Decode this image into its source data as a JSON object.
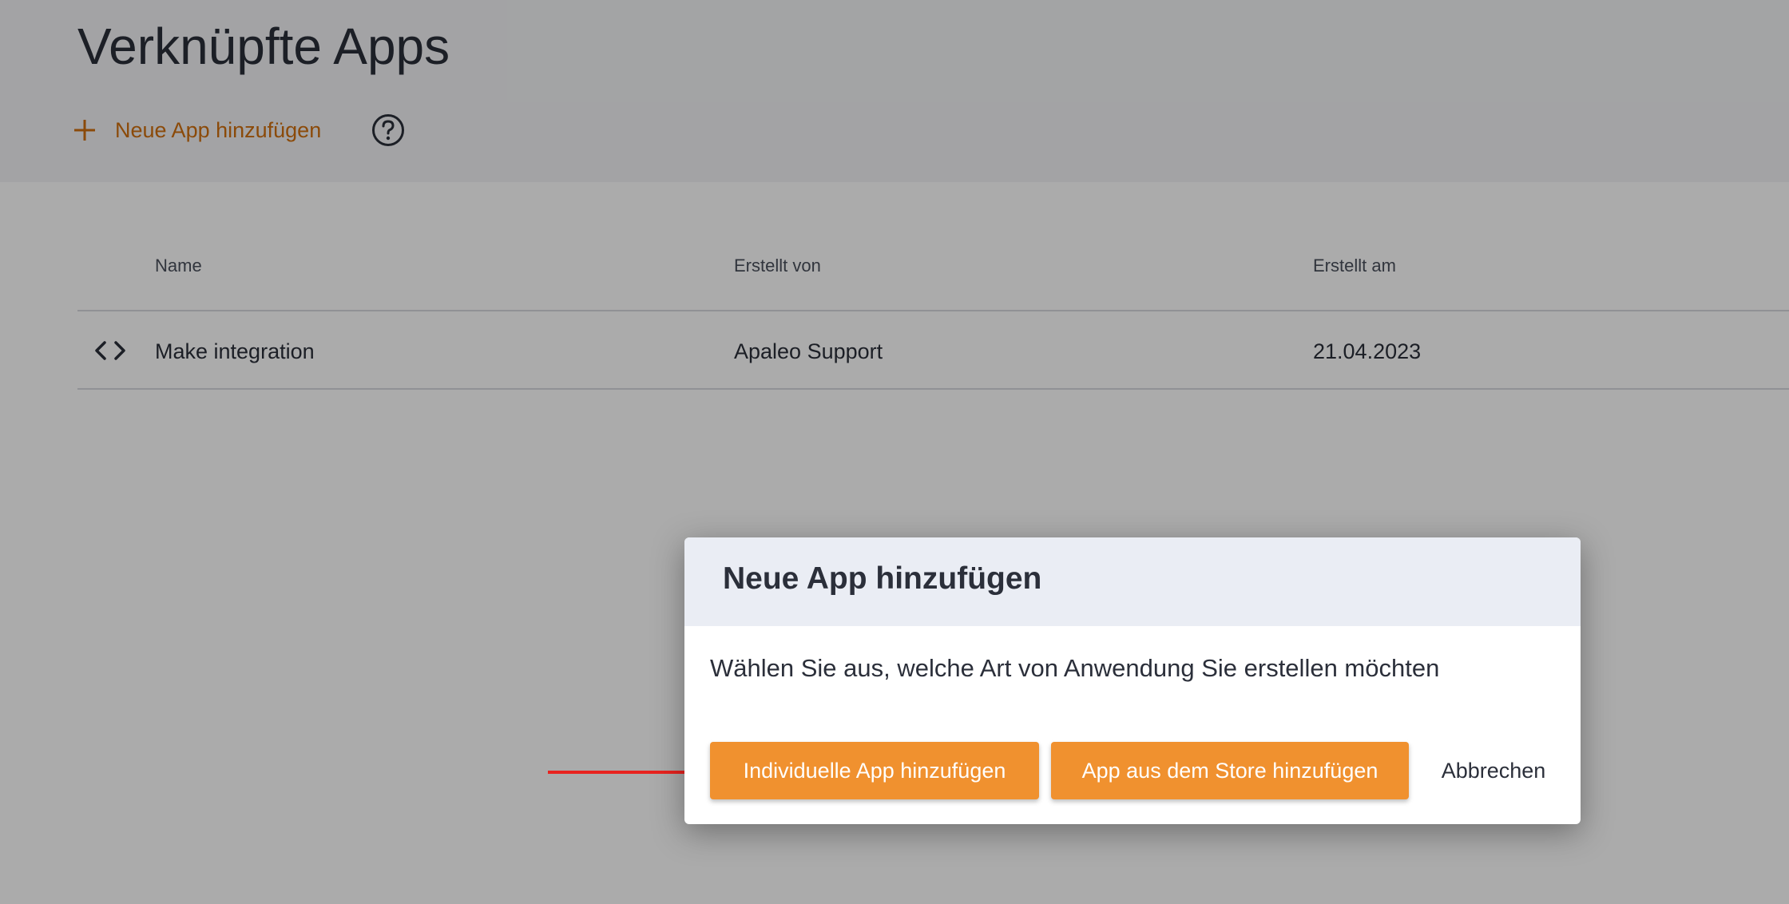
{
  "page": {
    "title": "Verknüpfte Apps",
    "add_app_label": "Neue App hinzufügen"
  },
  "icons": {
    "plus": "plus-icon",
    "help": "help-circle-icon",
    "code": "code-icon",
    "arrow": "arrow-right-icon"
  },
  "table": {
    "columns": [
      "Name",
      "Erstellt von",
      "Erstellt am"
    ],
    "rows": [
      {
        "name": "Make integration",
        "created_by": "Apaleo Support",
        "created_at": "21.04.2023"
      }
    ]
  },
  "dialog": {
    "title": "Neue App hinzufügen",
    "message": "Wählen Sie aus, welche Art von Anwendung Sie erstellen möchten",
    "custom_app_button": "Individuelle App hinzufügen",
    "store_app_button": "App aus dem Store hinzufügen",
    "cancel_button": "Abbrechen"
  },
  "colors": {
    "accent": "#f0912f",
    "link": "#d06f0e",
    "annotation_arrow": "#e8231f"
  }
}
